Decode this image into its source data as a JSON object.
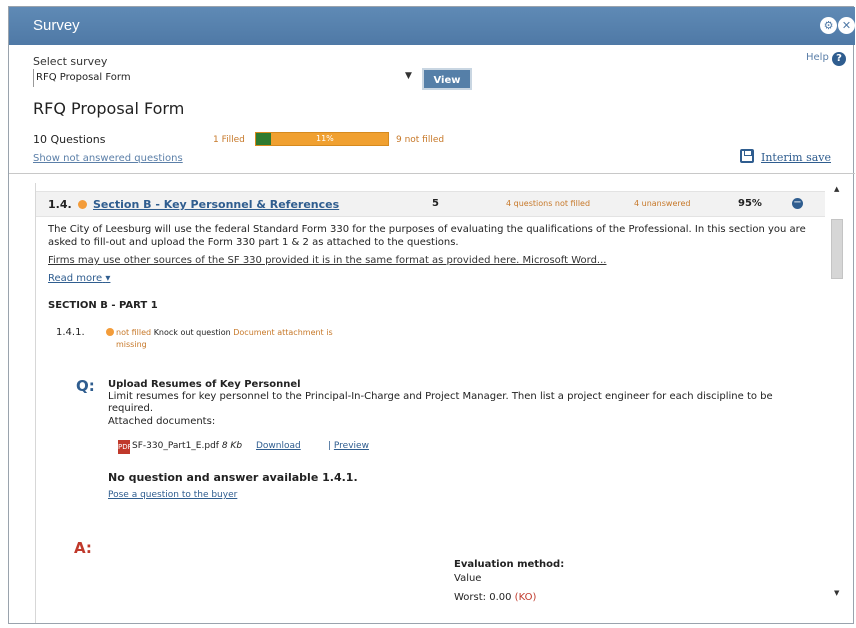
{
  "window": {
    "title": "Survey",
    "controls": [
      "gear-icon",
      "close-icon"
    ]
  },
  "survey_select": {
    "label": "Select survey",
    "value": "RFQ Proposal Form",
    "view_button": "View"
  },
  "help": {
    "label": "Help",
    "icon": "?"
  },
  "form": {
    "title": "RFQ Proposal Form",
    "question_count": "10 Questions",
    "filled_label": "1 Filled",
    "progress_percent": "11%",
    "progress_value": 0.11,
    "not_filled_label": "9 not filled",
    "show_not_answered": "Show not answered questions",
    "interim_save": "Interim save"
  },
  "section": {
    "number": "1.4.",
    "title": "Section B - Key Personnel & References",
    "count": "5",
    "questions_not_filled": "4 questions not filled",
    "unanswered": "4 unanswered",
    "percent": "95%",
    "intro": "The City of Leesburg will use the federal Standard Form 330 for the purposes of evaluating the qualifications of the Professional. In this section you are asked to fill-out and upload the Form 330 part 1 & 2 as attached to the questions.",
    "intro_more": "Firms may use other sources of the SF 330 provided it is in the same format as provided here.  Microsoft Word...",
    "read_more": "Read more"
  },
  "part": {
    "heading": "SECTION B - PART 1"
  },
  "question": {
    "number": "1.4.1.",
    "status_not_filled": "not filled",
    "status_knockout": "Knock out question",
    "status_document": "Document attachment is missing",
    "q_marker": "Q:",
    "title": "Upload Resumes of Key Personnel",
    "description": "Limit resumes for key personnel to the Principal-In-Charge and Project Manager. Then list a project engineer for each discipline to be required.",
    "attached_label": "Attached documents:",
    "attachment": {
      "name": "SF-330_Part1_E.pdf",
      "size": "8 Kb",
      "download": "Download",
      "preview": "Preview"
    },
    "no_qa": "No question and answer available",
    "no_qa_ref": "1.4.1.",
    "ask_buyer": "Pose a question to the buyer",
    "a_marker": "A:",
    "evaluation": {
      "title": "Evaluation method:",
      "value": "Value",
      "worst_label": "Worst: 0.00",
      "worst_flag": "(KO)"
    }
  },
  "colors": {
    "title_bar": "#5583b0",
    "progress_orange": "#f0a030",
    "progress_green": "#2f7a2f",
    "link": "#2f5d8f",
    "status_orange": "#c7792a",
    "answer_red": "#c0392b"
  }
}
